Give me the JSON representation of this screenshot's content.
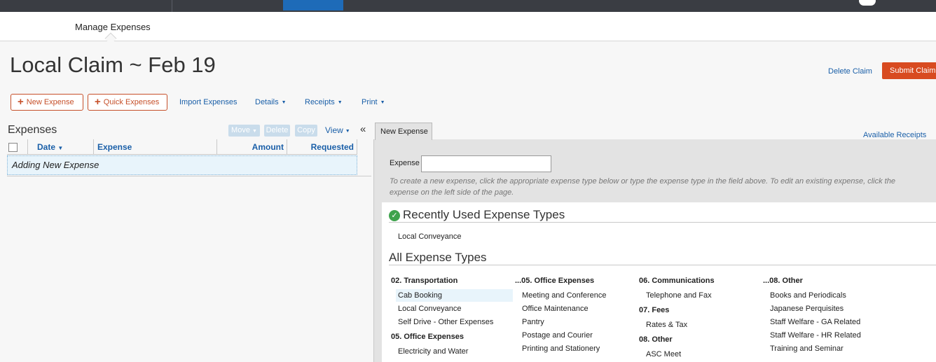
{
  "subnav": {
    "manage_expenses": "Manage Expenses"
  },
  "header": {
    "title": "Local Claim ~ Feb 19",
    "delete_claim": "Delete Claim",
    "submit_claim": "Submit Claim"
  },
  "toolbar": {
    "new_expense": "New Expense",
    "quick_expenses": "Quick Expenses",
    "import_expenses": "Import Expenses",
    "details": "Details",
    "receipts": "Receipts",
    "print": "Print"
  },
  "expenses_panel": {
    "heading": "Expenses",
    "move": "Move",
    "delete": "Delete",
    "copy": "Copy",
    "view": "View",
    "columns": {
      "date": "Date",
      "expense": "Expense",
      "amount": "Amount",
      "requested": "Requested"
    },
    "row": "Adding New Expense"
  },
  "right_panel": {
    "tab": "New Expense",
    "available_receipts": "Available Receipts",
    "expense_label": "Expense",
    "expense_value": "",
    "hint": "To create a new expense, click the appropriate expense type below or type the expense type in the field above. To edit an existing expense, click the expense on the left side of the page."
  },
  "recent": {
    "title": "Recently Used Expense Types",
    "items": [
      "Local Conveyance"
    ]
  },
  "all_types": {
    "title": "All Expense Types",
    "col1": {
      "cat1": "02. Transportation",
      "cat1_items": [
        "Cab Booking",
        "Local Conveyance",
        "Self Drive - Other Expenses"
      ],
      "cat2": "05. Office Expenses",
      "cat2_items": [
        "Electricity and Water"
      ]
    },
    "col2": {
      "cat1": "...05. Office Expenses",
      "cat1_items": [
        "Meeting and Conference",
        "Office Maintenance",
        "Pantry",
        "Postage and Courier",
        "Printing and Stationery"
      ]
    },
    "col3": {
      "cat1": "06. Communications",
      "cat1_items": [
        "Telephone and Fax"
      ],
      "cat2": "07. Fees",
      "cat2_items": [
        "Rates & Tax"
      ],
      "cat3": "08. Other",
      "cat3_items": [
        "ASC Meet"
      ]
    },
    "col4": {
      "cat1": "...08. Other",
      "cat1_items": [
        "Books and Periodicals",
        "Japanese Perquisites",
        "Staff Welfare - GA Related",
        "Staff Welfare - HR Related",
        "Training and Seminar"
      ]
    }
  }
}
